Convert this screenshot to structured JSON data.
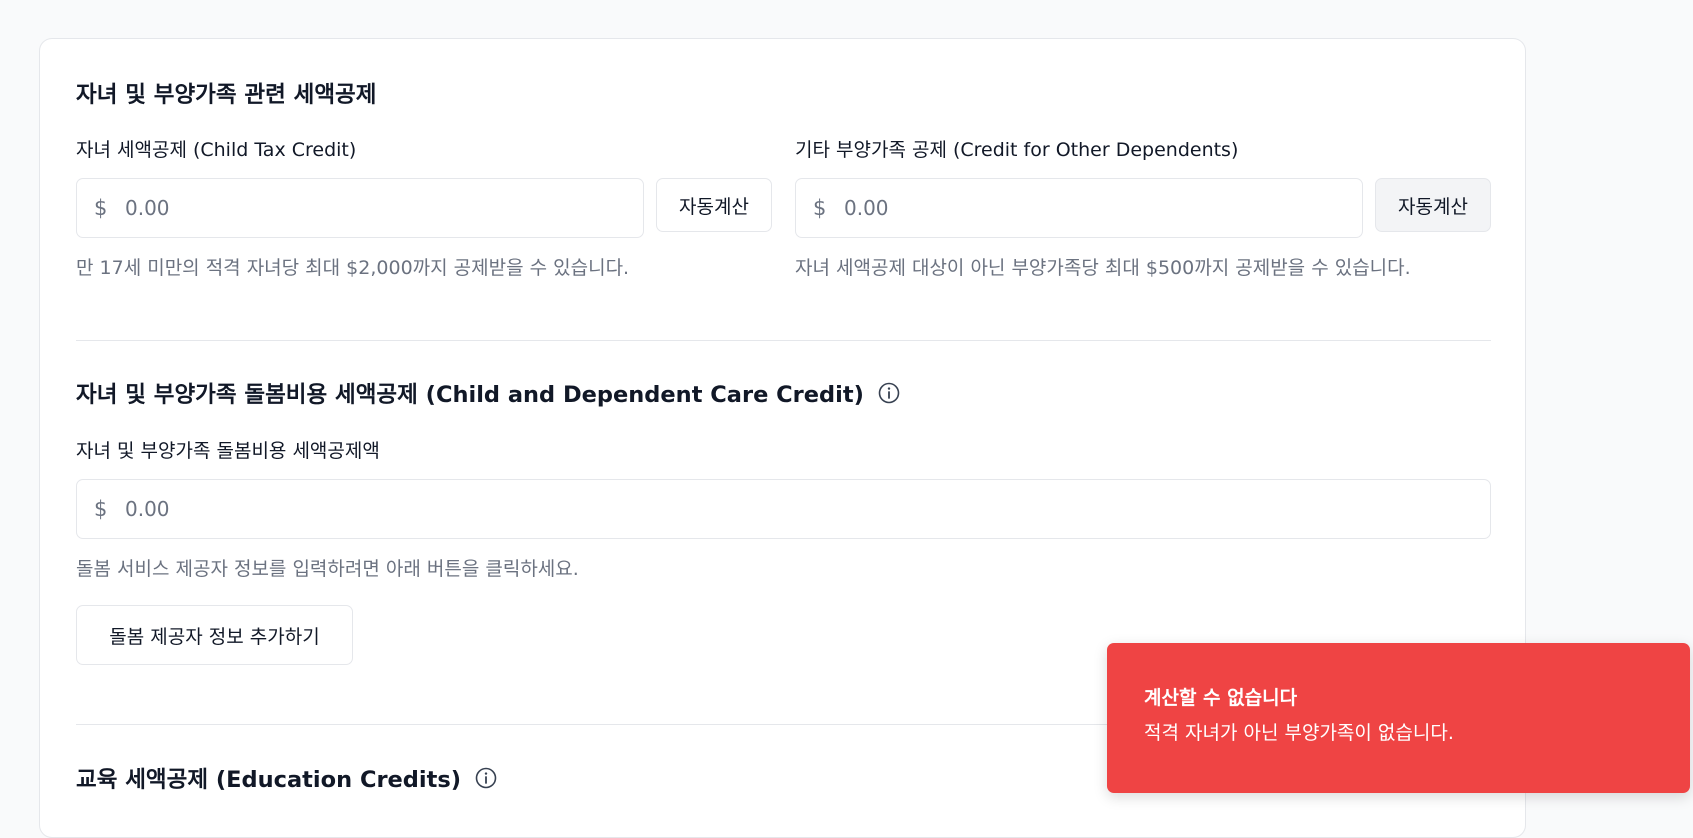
{
  "sections": {
    "child_dependents": {
      "title": "자녀 및 부양가족 관련 세액공제",
      "child_tax_credit": {
        "label": "자녀 세액공제 (Child Tax Credit)",
        "currency": "$",
        "placeholder": "0.00",
        "button": "자동계산",
        "help": "만 17세 미만의 적격 자녀당 최대 $2,000까지 공제받을 수 있습니다."
      },
      "other_dependents": {
        "label": "기타 부양가족 공제 (Credit for Other Dependents)",
        "currency": "$",
        "placeholder": "0.00",
        "button": "자동계산",
        "help": "자녀 세액공제 대상이 아닌 부양가족당 최대 $500까지 공제받을 수 있습니다."
      }
    },
    "care_credit": {
      "title": "자녀 및 부양가족 돌봄비용 세액공제 (Child and Dependent Care Credit)",
      "label": "자녀 및 부양가족 돌봄비용 세액공제액",
      "currency": "$",
      "placeholder": "0.00",
      "help": "돌봄 서비스 제공자 정보를 입력하려면 아래 버튼을 클릭하세요.",
      "add_button": "돌봄 제공자 정보 추가하기"
    },
    "education": {
      "title": "교육 세액공제 (Education Credits)"
    }
  },
  "toast": {
    "title": "계산할 수 없습니다",
    "description": "적격 자녀가 아닌 부양가족이 없습니다.",
    "color": "#ef4444"
  },
  "icons": {
    "info": "info-circle-icon"
  }
}
